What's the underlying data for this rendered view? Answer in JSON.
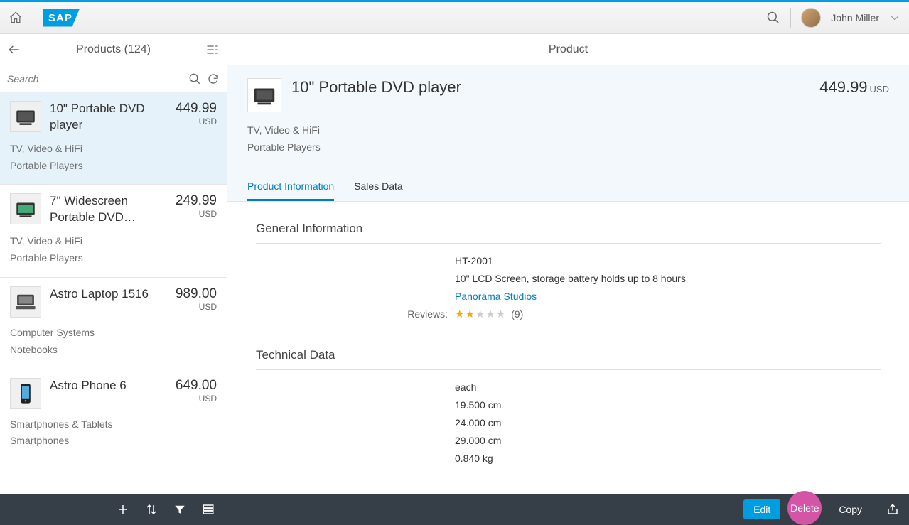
{
  "shell": {
    "user_name": "John Miller"
  },
  "master": {
    "title": "Products (124)",
    "search_placeholder": "Search"
  },
  "products": [
    {
      "name": "10\" Portable DVD player",
      "price": "449.99",
      "currency": "USD",
      "cat1": "TV, Video & HiFi",
      "cat2": "Portable Players",
      "selected": true
    },
    {
      "name": "7\" Widescreen Portable DVD…",
      "price": "249.99",
      "currency": "USD",
      "cat1": "TV, Video & HiFi",
      "cat2": "Portable Players",
      "selected": false
    },
    {
      "name": "Astro Laptop 1516",
      "price": "989.00",
      "currency": "USD",
      "cat1": "Computer Systems",
      "cat2": "Notebooks",
      "selected": false
    },
    {
      "name": "Astro Phone 6",
      "price": "649.00",
      "currency": "USD",
      "cat1": "Smartphones & Tablets",
      "cat2": "Smartphones",
      "selected": false
    }
  ],
  "detail": {
    "header_title": "Product",
    "title": "10\" Portable DVD player",
    "price": "449.99",
    "currency": "USD",
    "cat1": "TV, Video & HiFi",
    "cat2": "Portable Players",
    "tabs": {
      "info": "Product Information",
      "sales": "Sales Data"
    },
    "general": {
      "section_title": "General Information",
      "id": "HT-2001",
      "desc": "10\" LCD Screen, storage battery holds up to 8 hours",
      "supplier": "Panorama Studios",
      "reviews_label": "Reviews:",
      "rating": 2,
      "review_count": "(9)"
    },
    "technical": {
      "section_title": "Technical Data",
      "unit": "each",
      "dim1": "19.500 cm",
      "dim2": "24.000 cm",
      "dim3": "29.000 cm",
      "weight": "0.840 kg"
    }
  },
  "footer": {
    "edit": "Edit",
    "delete": "Delete",
    "copy": "Copy"
  }
}
